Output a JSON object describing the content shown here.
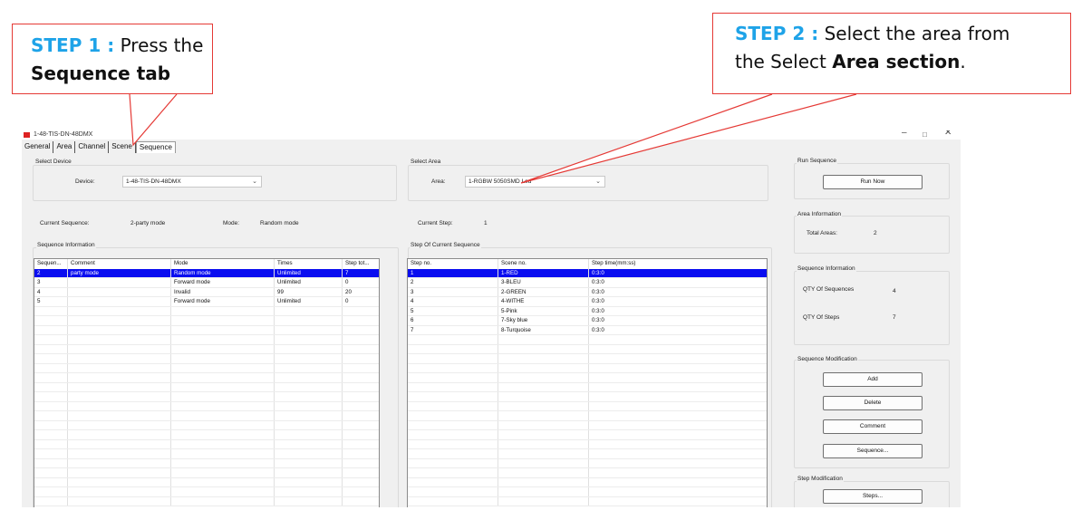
{
  "callouts": {
    "step1": {
      "step_label": "STEP 1 :",
      "text": "Press the",
      "bold": "Sequence tab"
    },
    "step2": {
      "step_label": "STEP 2 :",
      "text1": "Select the area from",
      "text2": "the Select",
      "bold": "Area section",
      "end": "."
    }
  },
  "colors": {
    "callout_border": "#e53935",
    "step_label": "#1ea3e8",
    "selection": "#0a0df0"
  },
  "window": {
    "title": "1-48-TIS-DN-48DMX",
    "controls": {
      "minimize": "–",
      "maximize": "□",
      "close": "✕"
    },
    "tabs": [
      {
        "label": "General",
        "active": false
      },
      {
        "label": "Area",
        "active": false
      },
      {
        "label": "Channel",
        "active": false
      },
      {
        "label": "Scene",
        "active": false
      },
      {
        "label": "Sequence",
        "active": true
      }
    ]
  },
  "select_device": {
    "group_label": "Select Device",
    "device_label": "Device:",
    "device_value": "1-48-TIS-DN-48DMX"
  },
  "current": {
    "sequence_label": "Current Sequence:",
    "sequence_value": "2-party mode",
    "mode_label": "Mode:",
    "mode_value": "Random mode"
  },
  "sequence_info": {
    "group_label": "Sequence Information",
    "columns": [
      "Sequen...",
      "Comment",
      "Mode",
      "Times",
      "Step tot..."
    ],
    "rows": [
      [
        "2",
        "party mode",
        "Random mode",
        "Unlimited",
        "7"
      ],
      [
        "3",
        "",
        "Forward mode",
        "Unlimited",
        "0"
      ],
      [
        "4",
        "",
        "Invalid",
        "99",
        "20"
      ],
      [
        "5",
        "",
        "Forward mode",
        "Unlimited",
        "0"
      ]
    ],
    "selected_row": 0
  },
  "select_area": {
    "group_label": "Select Area",
    "area_label": "Area:",
    "area_value": "1-RGBW 5050SMD Led"
  },
  "current_step": {
    "label": "Current Step:",
    "value": "1"
  },
  "step_info": {
    "group_label": "Step Of Current Sequence",
    "columns": [
      "Step no.",
      "Scene no.",
      "Step time(mm:ss)"
    ],
    "rows": [
      [
        "1",
        "1-RED",
        "0:3:0"
      ],
      [
        "2",
        "3-BLEU",
        "0:3:0"
      ],
      [
        "3",
        "2-GREEN",
        "0:3:0"
      ],
      [
        "4",
        "4-WITHE",
        "0:3:0"
      ],
      [
        "5",
        "5-Pink",
        "0:3:0"
      ],
      [
        "6",
        "7-Sky blue",
        "0:3:0"
      ],
      [
        "7",
        "8-Turquoise",
        "0:3:0"
      ]
    ],
    "selected_row": 0
  },
  "run_sequence": {
    "group_label": "Run Sequence",
    "button": "Run Now"
  },
  "area_information": {
    "group_label": "Area Information",
    "total_label": "Total Areas:",
    "total_value": "2"
  },
  "sequence_information_panel": {
    "group_label": "Sequence Information",
    "qty_seq_label": "QTY Of Sequences",
    "qty_seq_value": "4",
    "qty_steps_label": "QTY Of Steps",
    "qty_steps_value": "7"
  },
  "sequence_modification": {
    "group_label": "Sequence Modification",
    "add": "Add",
    "delete": "Delete",
    "comment": "Comment",
    "sequence": "Sequence..."
  },
  "step_modification": {
    "group_label": "Step Modification",
    "steps": "Steps..."
  }
}
